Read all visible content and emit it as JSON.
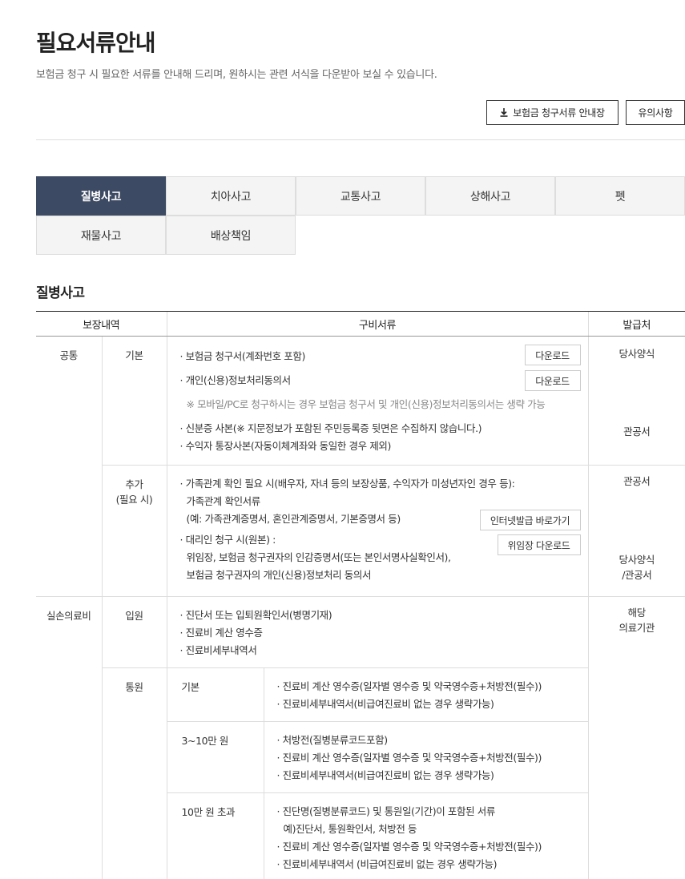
{
  "header": {
    "title": "필요서류안내",
    "description": "보험금 청구 시 필요한 서류를 안내해 드리며, 원하시는 관련 서식을 다운받아 보실 수 있습니다.",
    "guide_button": "보험금 청구서류 안내장",
    "notice_button": "유의사항"
  },
  "tabs": [
    "질병사고",
    "치아사고",
    "교통사고",
    "상해사고",
    "펫",
    "재물사고",
    "배상책임"
  ],
  "active_tab": "질병사고",
  "section_title": "질병사고",
  "table": {
    "headers": [
      "보장내역",
      "구비서류",
      "발급처"
    ],
    "common": {
      "group": "공통",
      "basic": {
        "label": "기본",
        "lines": [
          "· 보험금 청구서(계좌번호 포함)",
          "· 개인(신용)정보처리동의서",
          "※ 모바일/PC로 청구하시는 경우 보험금 청구서 및 개인(신용)정보처리동의서는 생략 가능",
          "· 신분증 사본(※ 지문정보가 포함된 주민등록증 뒷면은 수집하지 않습니다.)",
          "· 수익자 통장사본(자동이체계좌와 동일한 경우 제외)"
        ],
        "download1": "다운로드",
        "download2": "다운로드",
        "issuer1": "당사양식",
        "issuer2": "관공서"
      },
      "extra": {
        "label_line1": "추가",
        "label_line2": "(필요 시)",
        "lines": [
          "· 가족관계 확인 필요 시(배우자, 자녀 등의 보장상품, 수익자가 미성년자인 경우 등):",
          "가족관계 확인서류",
          "(예: 가족관계증명서, 혼인관계증명서, 기본증명서 등)",
          "· 대리인 청구 시(원본) :",
          "위임장, 보험금 청구권자의 인감증명서(또는 본인서명사실확인서),",
          "보험금 청구권자의 개인(신용)정보처리 동의서"
        ],
        "internet_button": "인터넷발급 바로가기",
        "proxy_button": "위임장 다운로드",
        "issuer1": "관공서",
        "issuer2_line1": "당사양식",
        "issuer2_line2": "/관공서"
      }
    },
    "medical": {
      "group": "실손의료비",
      "inpatient": {
        "label": "입원",
        "lines": [
          "· 진단서 또는 입퇴원확인서(병명기재)",
          "· 진료비 계산 영수증",
          "· 진료비세부내역서"
        ],
        "issuer_line1": "해당",
        "issuer_line2": "의료기관"
      },
      "outpatient": {
        "label": "통원",
        "rows": [
          {
            "label": "기본",
            "lines": [
              "· 진료비 계산 영수증(일자별 영수증 및 약국영수증+처방전(필수))",
              "· 진료비세부내역서(비급여진료비 없는 경우 생략가능)"
            ]
          },
          {
            "label": "3~10만 원",
            "lines": [
              "· 처방전(질병분류코드포함)",
              "· 진료비 계산 영수증(일자별 영수증 및 약국영수증+처방전(필수))",
              "· 진료비세부내역서(비급여진료비 없는 경우 생략가능)"
            ]
          },
          {
            "label": "10만 원 초과",
            "lines": [
              "· 진단명(질병분류코드) 및 통원일(기간)이 포함된 서류",
              "예)진단서, 통원확인서, 처방전 등",
              "· 진료비 계산 영수증(일자별 영수증 및 약국영수증+처방전(필수))",
              "· 진료비세부내역서 (비급여진료비 없는 경우 생략가능)"
            ]
          }
        ]
      }
    }
  }
}
